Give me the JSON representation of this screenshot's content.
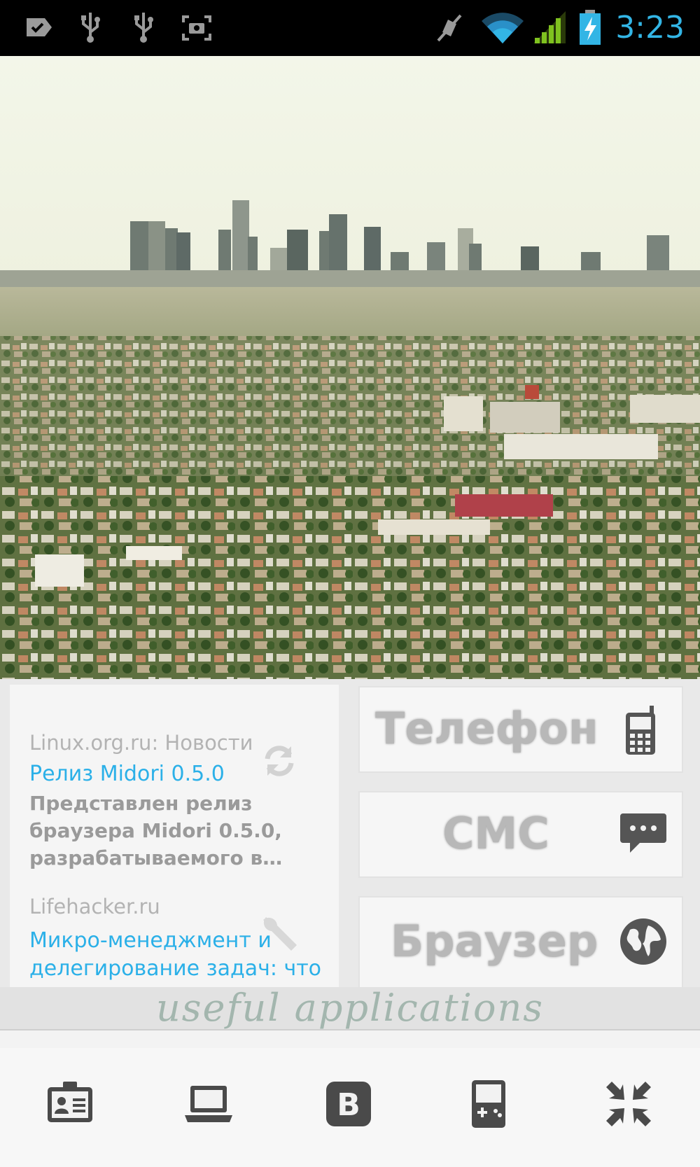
{
  "status_bar": {
    "time": "3:23",
    "icons": [
      "notification-tag-icon",
      "usb-icon",
      "usb-icon",
      "screenshot-icon",
      "mute-icon",
      "wifi-icon",
      "signal-icon",
      "battery-charging-icon"
    ],
    "accent_color": "#33b5e5"
  },
  "wallpaper": {
    "description_icon": "city-skyline-wallpaper"
  },
  "news_widget": {
    "items": [
      {
        "source": "Linux.org.ru: Новости",
        "title": "Релиз Midori 0.5.0",
        "summary": "Представлен релиз браузера Midori 0.5.0, разрабатываемого в…",
        "icon": "refresh-icon"
      },
      {
        "source": "Lifehacker.ru",
        "title": "Микро-менеджмент и делегирование задач: что",
        "icon": "wrench-icon"
      }
    ],
    "link_color": "#2bb0e8"
  },
  "shortcuts": [
    {
      "label": "Телефон",
      "icon": "phone-icon"
    },
    {
      "label": "СМС",
      "icon": "message-icon"
    },
    {
      "label": "Браузер",
      "icon": "globe-icon"
    }
  ],
  "caption": "useful applications",
  "dock": [
    {
      "icon": "contacts-card-icon"
    },
    {
      "icon": "laptop-icon"
    },
    {
      "icon": "vk-icon"
    },
    {
      "icon": "gameboy-icon"
    },
    {
      "icon": "shrink-arrows-icon"
    }
  ]
}
